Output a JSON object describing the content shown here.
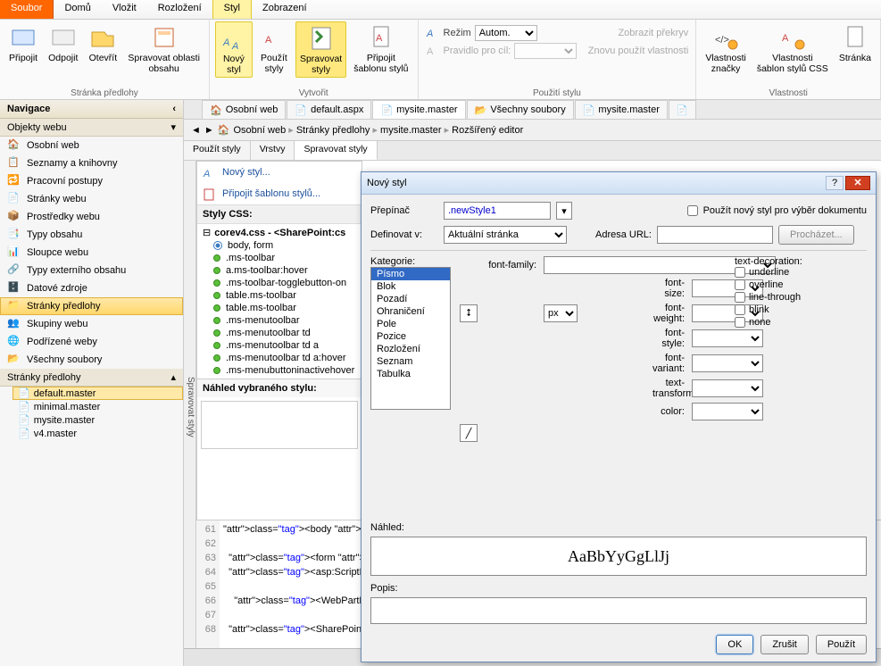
{
  "menu": {
    "file": "Soubor",
    "items": [
      "Domů",
      "Vložit",
      "Rozložení",
      "Styl",
      "Zobrazení"
    ],
    "active": 3
  },
  "ribbon": {
    "g0": {
      "label": "Stránka předlohy",
      "btns": [
        "Připojit",
        "Odpojit",
        "Otevřít",
        "Spravovat oblasti\nobsahu"
      ]
    },
    "g1": {
      "label": "Vytvořit",
      "btns": [
        "Nový\nstyl",
        "Použít\nstyly",
        "Spravovat\nstyly",
        "Připojit\nšablonu stylů"
      ]
    },
    "g2": {
      "label": "Použití stylu",
      "mode": "Režim",
      "mode_v": "Autom.",
      "overlay": "Zobrazit překryv",
      "rulefor": "Pravidlo pro cíl:",
      "reuse": "Znovu použít vlastnosti"
    },
    "g3": {
      "label": "Vlastnosti",
      "btns": [
        "Vlastnosti\nznačky",
        "Vlastnosti\nšablon stylů CSS",
        "Stránka"
      ]
    }
  },
  "nav": {
    "title": "Navigace",
    "objects": "Objekty webu",
    "items": [
      "Osobní web",
      "Seznamy a knihovny",
      "Pracovní postupy",
      "Stránky webu",
      "Prostředky webu",
      "Typy obsahu",
      "Sloupce webu",
      "Typy externího obsahu",
      "Datové zdroje",
      "Stránky předlohy",
      "Skupiny webu",
      "Podřízené weby",
      "Všechny soubory"
    ],
    "sel": 9,
    "sub_title": "Stránky předlohy",
    "files": [
      "default.master",
      "minimal.master",
      "mysite.master",
      "v4.master"
    ],
    "file_sel": 0
  },
  "tabs": [
    "Osobní web",
    "default.aspx",
    "mysite.master",
    "Všechny soubory",
    "mysite.master"
  ],
  "tab_active": 2,
  "breadcrumb": [
    "Osobní web",
    "Stránky předlohy",
    "mysite.master",
    "Rozšířený editor"
  ],
  "ed_tabs": [
    "Použít styly",
    "Vrstvy",
    "Spravovat styly"
  ],
  "ed_tab_active": 2,
  "sp": {
    "new": "Nový styl...",
    "attach": "Připojit šablonu stylů...",
    "css_label": "Styly CSS:",
    "root": "corev4.css - <SharePoint:cs",
    "rules": [
      "body, form",
      ".ms-toolbar",
      "a.ms-toolbar:hover",
      ".ms-toolbar-togglebutton-on",
      "table.ms-toolbar",
      "table.ms-toolbar",
      ".ms-menutoolbar",
      ".ms-menutoolbar td",
      ".ms-menutoolbar td a",
      ".ms-menutoolbar td a:hover",
      ".ms-menubuttoninactivehover"
    ],
    "sel": 0,
    "preview": "Náhled vybraného stylu:",
    "vtab": "Spravovat styly"
  },
  "code": {
    "start": 61,
    "lines": [
      "<body scroll=\"no\" onloa",
      "",
      "  <form runat=\"server\"",
      "  <asp:ScriptManager i",
      "",
      "    <WebPartPages:SPWe",
      "",
      "  <SharePoint:SPNoScri"
    ]
  },
  "dlg": {
    "title": "Nový styl",
    "selector_l": "Přepínač",
    "selector_v": ".newStyle1",
    "definein_l": "Definovat v:",
    "definein_v": "Aktuální stránka",
    "url_l": "Adresa URL:",
    "url_v": "",
    "browse": "Procházet...",
    "apply_chk": "Použít nový styl pro výběr dokumentu",
    "cat_l": "Kategorie:",
    "cats": [
      "Písmo",
      "Blok",
      "Pozadí",
      "Ohraničení",
      "Pole",
      "Pozice",
      "Rozložení",
      "Seznam",
      "Tabulka"
    ],
    "cat_sel": 0,
    "font_labels": [
      "font-family:",
      "font-size:",
      "font-weight:",
      "font-style:",
      "font-variant:",
      "text-transform:",
      "color:"
    ],
    "unit": "px",
    "deco_title": "text-decoration:",
    "deco": [
      "underline",
      "overline",
      "line-through",
      "blink",
      "none"
    ],
    "preview_l": "Náhled:",
    "preview_t": "AaBbYyGgLlJj",
    "desc_l": "Popis:",
    "ok": "OK",
    "cancel": "Zrušit",
    "apply": "Použít"
  }
}
